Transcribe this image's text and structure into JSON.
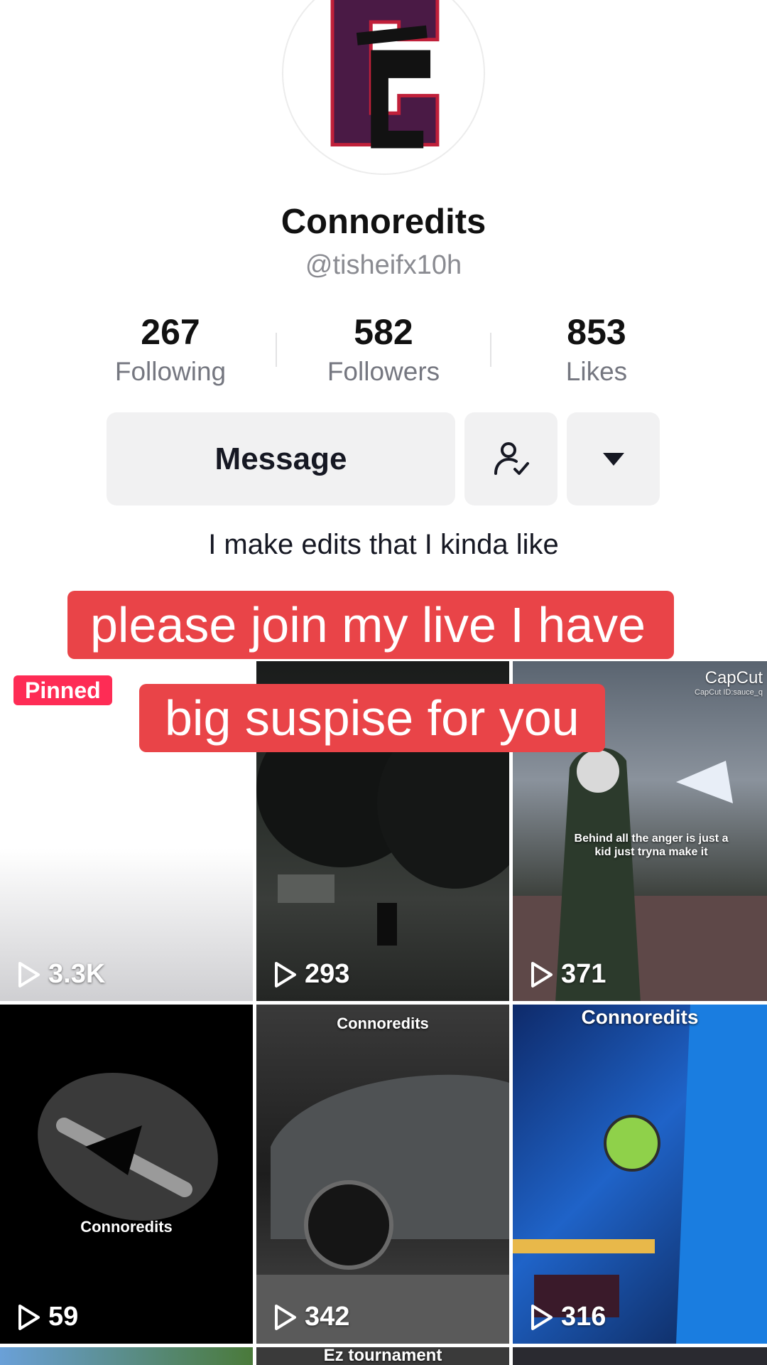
{
  "profile": {
    "display_name": "Connoredits",
    "handle": "@tisheifx10h",
    "bio": "I make edits that I kinda like"
  },
  "stats": [
    {
      "value": "267",
      "label": "Following"
    },
    {
      "value": "582",
      "label": "Followers"
    },
    {
      "value": "853",
      "label": "Likes"
    }
  ],
  "actions": {
    "message_label": "Message",
    "friend_icon": "user-check-icon",
    "more_icon": "caret-down-icon"
  },
  "overlay": {
    "line1": "please join my live I have",
    "line2": "big suspise for you"
  },
  "videos": [
    {
      "views": "3.3K",
      "pinned_label": "Pinned"
    },
    {
      "views": "293"
    },
    {
      "views": "371",
      "caption": "Behind all the anger is just a kid just tryna make it",
      "watermark": "CapCut",
      "watermark_sub": "CapCut ID:sauce_q"
    },
    {
      "views": "59",
      "caption": "Connoredits"
    },
    {
      "views": "342",
      "caption": "Connoredits"
    },
    {
      "views": "316",
      "caption": "Connoredits"
    },
    {
      "caption": "Ez tournament"
    }
  ],
  "colors": {
    "accent": "#fe2c55",
    "sticker": "#e94448",
    "button_bg": "#f1f1f2"
  }
}
